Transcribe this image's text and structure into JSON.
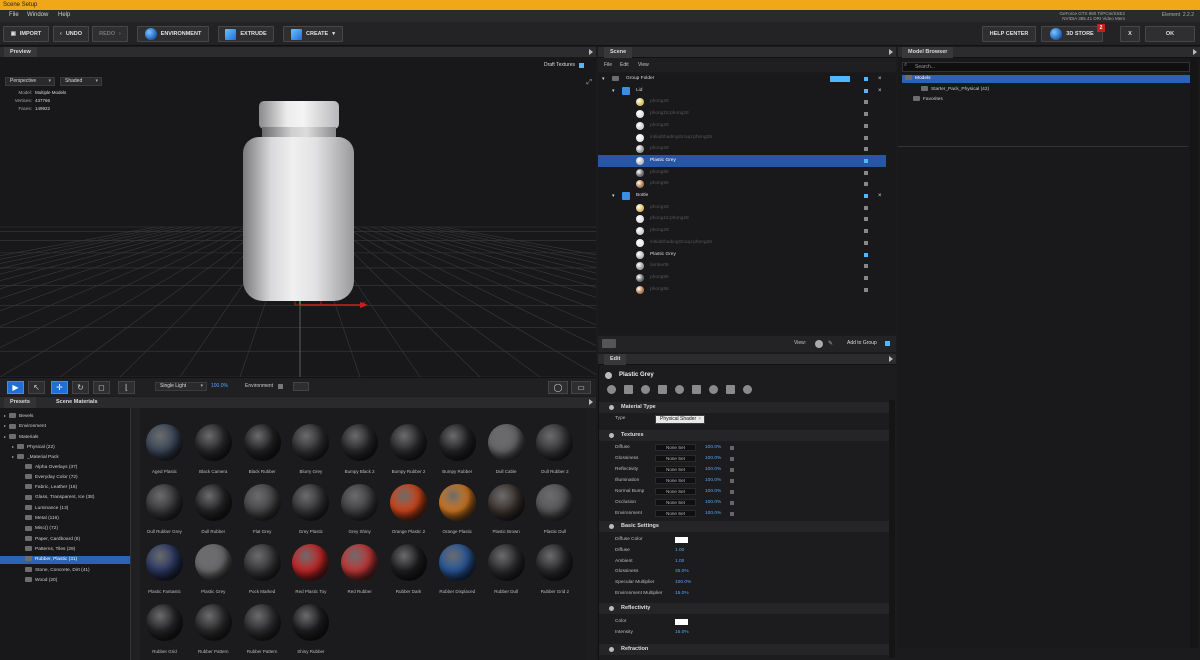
{
  "window": {
    "title": "Scene Setup"
  },
  "menu": {
    "file": "File",
    "window": "Window",
    "help": "Help"
  },
  "sysinfo": {
    "line1": "GeForce GTX 980 Ti/PCIe/SSE2",
    "line2": "NVIDIA 385.41 DRI Video Mem",
    "element": "Element",
    "version": "2.2.2"
  },
  "toolbar": {
    "import": "IMPORT",
    "undo": "UNDO",
    "redo": "REDO",
    "environment": "ENVIRONMENT",
    "extrude": "EXTRUDE",
    "create": "CREATE",
    "help_center": "HELP CENTER",
    "store": "3D STORE",
    "store_badge": "2",
    "close": "X",
    "ok": "OK"
  },
  "preview": {
    "tab": "Preview",
    "draft_textures": "Draft Textures",
    "camera": "Perspective",
    "shading": "Shaded",
    "stats": {
      "model_label": "Model:",
      "model": "Multiple Models",
      "vertices_label": "Vertices:",
      "vertices": "437766",
      "faces_label": "Faces:",
      "faces": "149922"
    },
    "light": "Single Light",
    "light_pct": "100.0%",
    "env_label": "Environment",
    "axis_y": "Y",
    "axis_x": "X"
  },
  "lower": {
    "tab_presets": "Presets",
    "tab_scene_materials": "Scene Materials",
    "tree": [
      {
        "label": "Bevels",
        "depth": 0
      },
      {
        "label": "Environment",
        "depth": 0
      },
      {
        "label": "Materials",
        "depth": 0
      },
      {
        "label": "Physical (22)",
        "depth": 1
      },
      {
        "label": "_Material Pack",
        "depth": 1
      },
      {
        "label": "Alpha Overlays (37)",
        "depth": 2
      },
      {
        "label": "Everyday Color (72)",
        "depth": 2
      },
      {
        "label": "Fabric, Leather (16)",
        "depth": 2
      },
      {
        "label": "Glass, Transparent, Ice (38)",
        "depth": 2
      },
      {
        "label": "Luminance (13)",
        "depth": 2
      },
      {
        "label": "Metal (116)",
        "depth": 2
      },
      {
        "label": "Misc() (72)",
        "depth": 2
      },
      {
        "label": "Paper, Cardboard (8)",
        "depth": 2
      },
      {
        "label": "Patterns, Tiles (29)",
        "depth": 2
      },
      {
        "label": "Rubber, Plastic (31)",
        "depth": 2,
        "selected": true
      },
      {
        "label": "Stone, Concrete, Dirt (41)",
        "depth": 2
      },
      {
        "label": "Wood (20)",
        "depth": 2
      }
    ],
    "materials": [
      {
        "name": "Aged Plastic",
        "color": "#3e4a5c"
      },
      {
        "name": "Black Camera",
        "color": "#2a2a2c"
      },
      {
        "name": "Black Rubber",
        "color": "#242426"
      },
      {
        "name": "Blurry Grey",
        "color": "#333336"
      },
      {
        "name": "Bumpy Black 2",
        "color": "#2a2a2d"
      },
      {
        "name": "Bumpy Rubber 2",
        "color": "#2c2c2f"
      },
      {
        "name": "Bumpy Rubber",
        "color": "#262628"
      },
      {
        "name": "Dull Cable",
        "color": "#6a6a6c"
      },
      {
        "name": "Dull Rubber 2",
        "color": "#3a3a3c"
      },
      {
        "name": "Dull Rubber Grey",
        "color": "#3c3c40"
      },
      {
        "name": "Dull Rubber",
        "color": "#262628"
      },
      {
        "name": "Flat Grey",
        "color": "#4a4a4c"
      },
      {
        "name": "Grey Plastic",
        "color": "#38383b"
      },
      {
        "name": "Grey Shiny",
        "color": "#444447"
      },
      {
        "name": "Orange Plastic 2",
        "color": "#d8481a"
      },
      {
        "name": "Orange Plastic",
        "color": "#d87c22"
      },
      {
        "name": "Plastic Brown",
        "color": "#3e3632"
      },
      {
        "name": "Plastic Dull",
        "color": "#5a5a5c"
      },
      {
        "name": "Plastic Fantastic",
        "color": "#2e3a66"
      },
      {
        "name": "Plastic Grey",
        "color": "#707072"
      },
      {
        "name": "Pock Marked",
        "color": "#3a3a3c"
      },
      {
        "name": "Red Plastic Toy",
        "color": "#cc2828"
      },
      {
        "name": "Red Rubber",
        "color": "#c83a3a"
      },
      {
        "name": "Rubber Dark",
        "color": "#202022"
      },
      {
        "name": "Rubber Displaced",
        "color": "#2a5aa0"
      },
      {
        "name": "Rubber Dull",
        "color": "#2e2e30"
      },
      {
        "name": "Rubber Grid 2",
        "color": "#2c2c2e"
      },
      {
        "name": "Rubber Grid",
        "color": "#262628"
      },
      {
        "name": "Rubber Pattern",
        "color": "#2c2c2e"
      },
      {
        "name": "Rubber Pattern",
        "color": "#303032"
      },
      {
        "name": "Shiny Rubber",
        "color": "#202022"
      }
    ]
  },
  "scene": {
    "tab": "Scene",
    "menu": [
      "File",
      "Edit",
      "View"
    ],
    "rows": [
      {
        "label": "Group Folder",
        "indent": 0,
        "type": "folder",
        "visible": true
      },
      {
        "label": "Lid",
        "indent": 1,
        "type": "mesh",
        "visible": true
      },
      {
        "label": "phong28",
        "indent": 2,
        "color": "#d8c060"
      },
      {
        "label": "phong15:phong28",
        "indent": 2,
        "color": "#e0e0e0"
      },
      {
        "label": "phong28",
        "indent": 2,
        "color": "#cfcfcf"
      },
      {
        "label": "initialShadingGroup:phong28",
        "indent": 2,
        "color": "#e8e8e8"
      },
      {
        "label": "phong28",
        "indent": 2,
        "color": "#9a9a9a"
      },
      {
        "label": "Plastic Grey",
        "indent": 2,
        "color": "#bdbdbd",
        "visible": true,
        "selected": true
      },
      {
        "label": "phong96",
        "indent": 2,
        "color": "#666"
      },
      {
        "label": "phong96",
        "indent": 2,
        "color": "#b07848"
      },
      {
        "label": "Bottle",
        "indent": 1,
        "type": "mesh",
        "visible": true
      },
      {
        "label": "phong28",
        "indent": 2,
        "color": "#d8c060"
      },
      {
        "label": "phong15:phong28",
        "indent": 2,
        "color": "#e0e0e0"
      },
      {
        "label": "phong28",
        "indent": 2,
        "color": "#cfcfcf"
      },
      {
        "label": "initialShadingGroup:phong28",
        "indent": 2,
        "color": "#e8e8e8"
      },
      {
        "label": "Plastic Grey",
        "indent": 2,
        "color": "#bdbdbd",
        "visible": true
      },
      {
        "label": "lambert6",
        "indent": 2,
        "color": "#9a9a9a"
      },
      {
        "label": "phong96",
        "indent": 2,
        "color": "#666"
      },
      {
        "label": "phong96",
        "indent": 2,
        "color": "#b07848"
      }
    ],
    "view_label": "View:",
    "add_to_group": "Add to Group"
  },
  "edit": {
    "tab": "Edit",
    "material": "Plastic Grey",
    "material_type_section": "Material Type",
    "type_label": "Type",
    "type_value": "Physical Shader",
    "textures_section": "Textures",
    "textures": [
      {
        "label": "Diffuse",
        "value": "None Set",
        "pct": "100.0%"
      },
      {
        "label": "Glossiness",
        "value": "None Set",
        "pct": "100.0%"
      },
      {
        "label": "Reflectivity",
        "value": "None Set",
        "pct": "100.0%"
      },
      {
        "label": "Illumination",
        "value": "None Set",
        "pct": "100.0%"
      },
      {
        "label": "Normal Bump",
        "value": "None Set",
        "pct": "100.0%"
      },
      {
        "label": "Occlusion",
        "value": "None Set",
        "pct": "100.0%"
      },
      {
        "label": "Environment",
        "value": "None Set",
        "pct": "100.0%"
      }
    ],
    "basic_section": "Basic Settings",
    "basic": [
      {
        "label": "Diffuse Color",
        "value": ""
      },
      {
        "label": "Diffuse",
        "value": "1.00"
      },
      {
        "label": "Ambient",
        "value": "1.00"
      },
      {
        "label": "Glossiness",
        "value": "35.0%"
      },
      {
        "label": "Specular Multiplier",
        "value": "100.0%"
      },
      {
        "label": "Environment Multiplier",
        "value": "15.0%"
      }
    ],
    "reflectivity_section": "Reflectivity",
    "refl": [
      {
        "label": "Color",
        "value": ""
      },
      {
        "label": "Intensity",
        "value": "15.0%"
      }
    ],
    "refraction_section": "Refraction"
  },
  "model_browser": {
    "tab": "Model Browser",
    "search_placeholder": "Search...",
    "items": [
      {
        "label": "Models",
        "indent": 0,
        "selected": true
      },
      {
        "label": "Starter_Pack_Physical (42)",
        "indent": 2
      },
      {
        "label": "Favorites",
        "indent": 1
      }
    ]
  }
}
